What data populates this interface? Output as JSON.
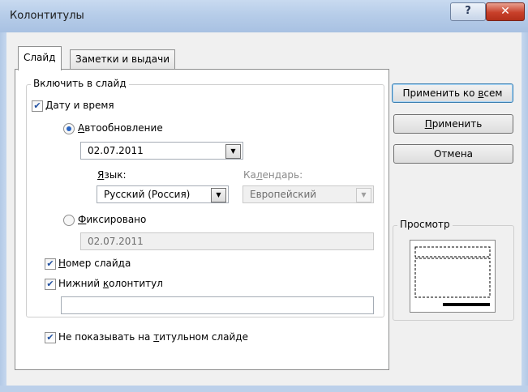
{
  "window": {
    "title": "Колонтитулы",
    "help_label": "?",
    "close_label": "✕"
  },
  "tabs": [
    {
      "label": "Слайд",
      "active": true
    },
    {
      "label": "Заметки и выдачи",
      "active": false
    }
  ],
  "group": {
    "legend": "Включить в слайд",
    "datetime": {
      "label_u": "Д",
      "label_rest": "ату и время",
      "checked": true
    },
    "auto_update": {
      "label_u": "А",
      "label_rest": "втообновление",
      "selected": true,
      "value": "02.07.2011"
    },
    "language": {
      "label_u": "Я",
      "label_rest": "зык:",
      "value": "Русский (Россия)"
    },
    "calendar": {
      "label_pre": "Ка",
      "label_u": "л",
      "label_rest": "ендарь:",
      "value": "Европейский"
    },
    "fixed": {
      "label_u": "Ф",
      "label_rest": "иксировано",
      "selected": false,
      "value": "02.07.2011"
    },
    "slide_number": {
      "label_u": "Н",
      "label_rest": "омер слайда",
      "checked": true
    },
    "footer": {
      "label_pre": "Нижний ",
      "label_u": "к",
      "label_rest": "олонтитул",
      "checked": true,
      "value": ""
    }
  },
  "title_slide": {
    "label_pre": "Не показывать на ",
    "label_u": "т",
    "label_rest": "итульном слайде",
    "checked": true
  },
  "buttons": {
    "apply_all": {
      "pre": "Применить ко ",
      "u": "в",
      "rest": "сем"
    },
    "apply": {
      "pre": "",
      "u": "П",
      "rest": "рименить"
    },
    "cancel": {
      "label": "Отмена"
    }
  },
  "preview": {
    "legend": "Просмотр"
  }
}
